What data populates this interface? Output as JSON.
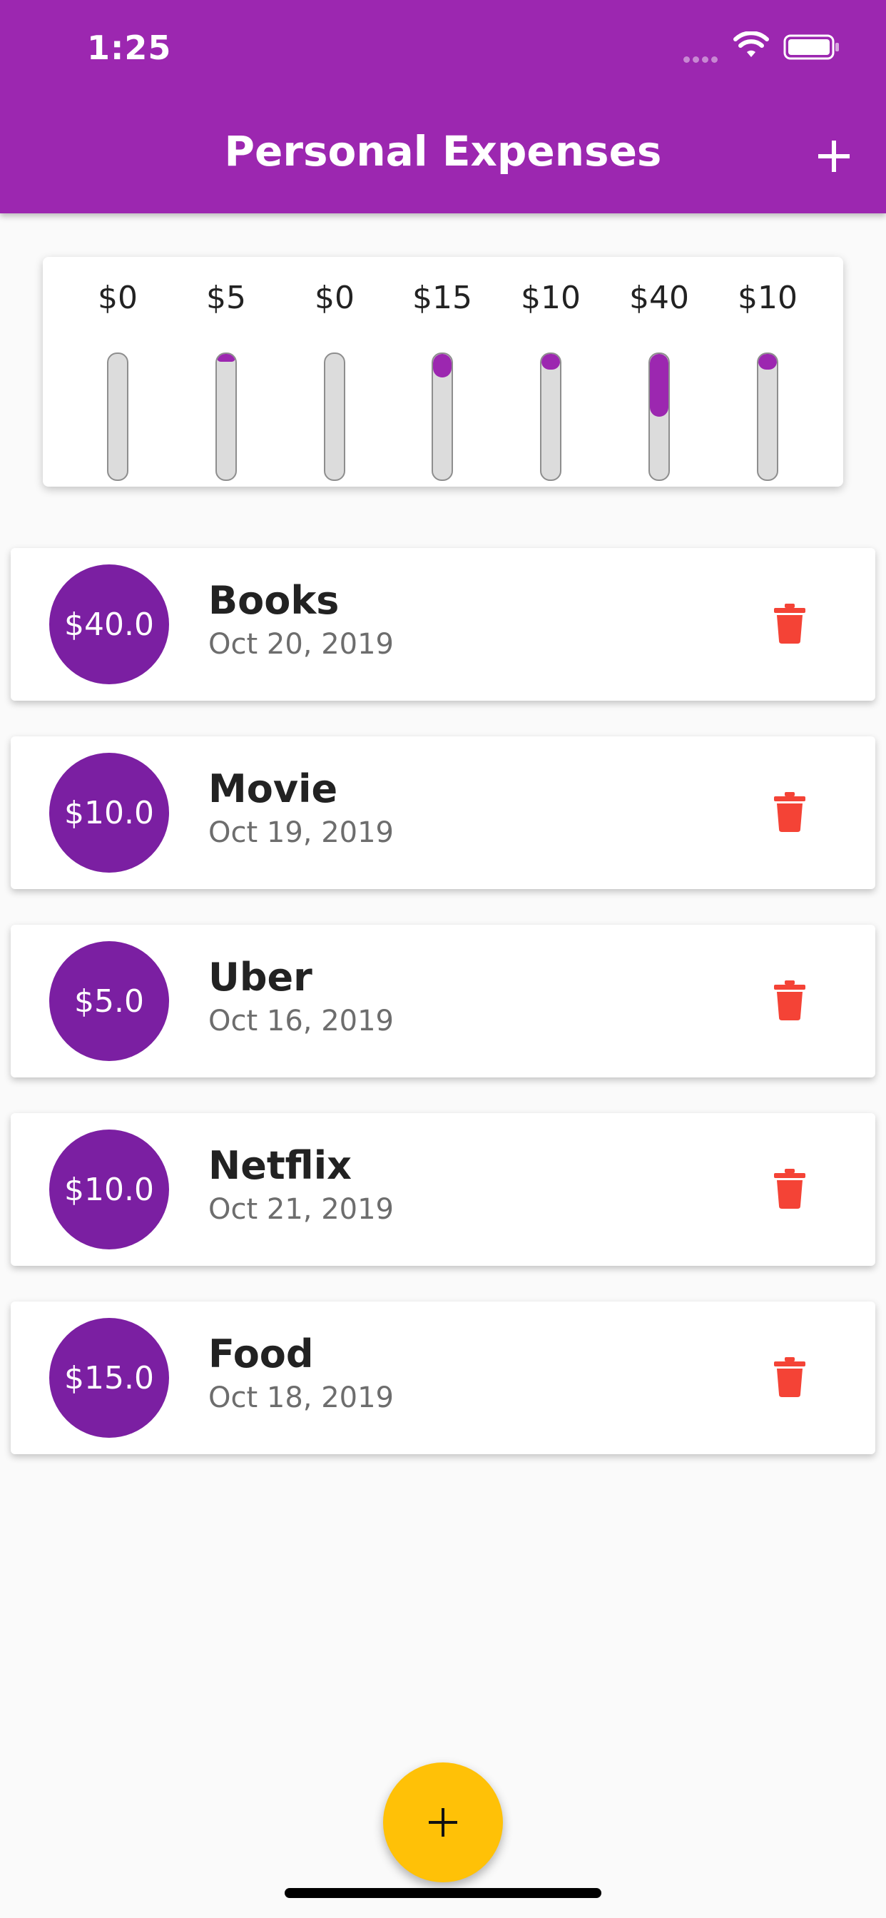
{
  "status_bar": {
    "time": "1:25"
  },
  "app_bar": {
    "title": "Personal Expenses",
    "add_icon": "plus-icon"
  },
  "chart": {
    "max_amount": 40,
    "days": [
      {
        "label": "$0",
        "amount": 0
      },
      {
        "label": "$5",
        "amount": 5
      },
      {
        "label": "$0",
        "amount": 0
      },
      {
        "label": "$15",
        "amount": 15
      },
      {
        "label": "$10",
        "amount": 10
      },
      {
        "label": "$40",
        "amount": 40
      },
      {
        "label": "$10",
        "amount": 10
      }
    ]
  },
  "transactions": [
    {
      "amount": "$40.0",
      "title": "Books",
      "date": "Oct 20, 2019"
    },
    {
      "amount": "$10.0",
      "title": "Movie",
      "date": "Oct 19, 2019"
    },
    {
      "amount": "$5.0",
      "title": "Uber",
      "date": "Oct 16, 2019"
    },
    {
      "amount": "$10.0",
      "title": "Netflix",
      "date": "Oct 21, 2019"
    },
    {
      "amount": "$15.0",
      "title": "Food",
      "date": "Oct 18, 2019"
    }
  ],
  "colors": {
    "primary": "#9c27b0",
    "amount_circle": "#7b1fa2",
    "delete": "#f44336",
    "fab": "#ffc107"
  },
  "fab": {
    "icon": "plus-icon"
  }
}
